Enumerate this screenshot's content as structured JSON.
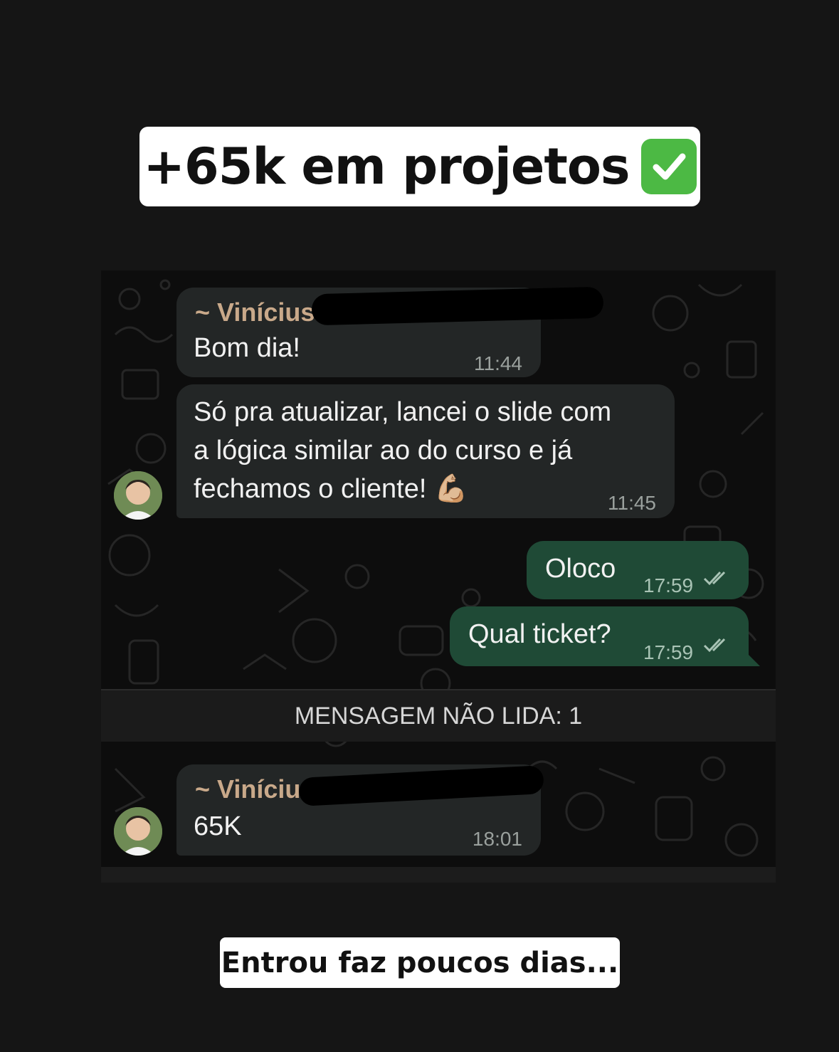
{
  "caption_top": {
    "text": "+65k em projetos"
  },
  "caption_bottom": {
    "text": "Entrou faz poucos dias..."
  },
  "chat": {
    "messages": [
      {
        "sender": "~ Vinícius",
        "text": "Bom dia!",
        "time": "11:44"
      },
      {
        "text_lines": [
          "Só pra atualizar, lancei o slide com",
          "a lógica similar ao do curso e já",
          "fechamos o cliente! 💪🏼"
        ],
        "time": "11:45"
      },
      {
        "text": "Oloco",
        "time": "17:59",
        "status": "read"
      },
      {
        "text": "Qual ticket?",
        "time": "17:59",
        "status": "read"
      },
      {
        "sender": "~ Vinícius",
        "text": "65K",
        "time": "18:01"
      }
    ],
    "unread_label": "MENSAGEM NÃO LIDA: 1"
  },
  "colors": {
    "background": "#151515",
    "incoming_bubble": "#232626",
    "outgoing_bubble": "#1f4a36",
    "sender_name": "#c9a98a",
    "check_emoji": "#4cb944"
  }
}
